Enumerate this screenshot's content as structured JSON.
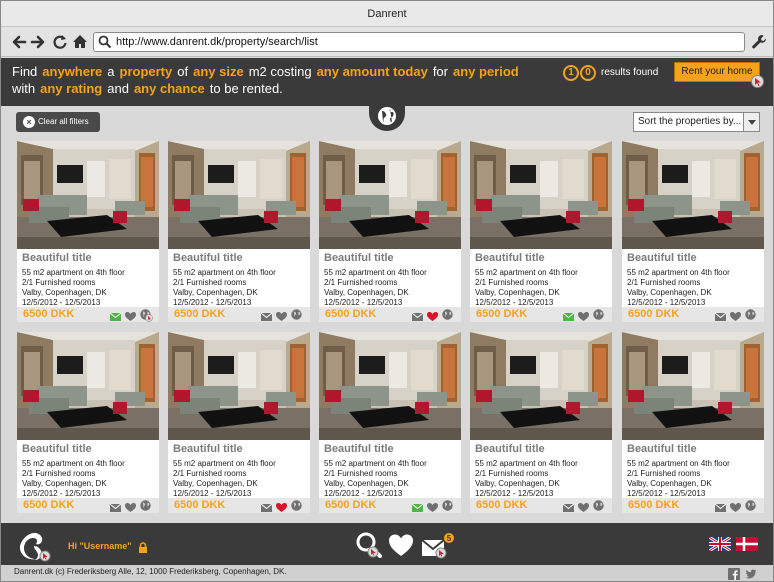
{
  "window": {
    "title": "Danrent"
  },
  "toolbar": {
    "url": "http://www.danrent.dk/property/search/list",
    "icons": [
      "back-arrow-icon",
      "forward-arrow-icon",
      "reload-icon",
      "home-icon",
      "search-icon",
      "wrench-icon"
    ]
  },
  "hero": {
    "line1": {
      "w1": "Find",
      "o1": "anywhere",
      "w2": "a",
      "o2": "property",
      "w3": "of",
      "o3": "any size",
      "w4": "m2 costing",
      "o4": "any amount today",
      "w5": "for",
      "o5": "any period"
    },
    "line2": {
      "w1": "with",
      "o1": "any rating",
      "w2": "and",
      "o2": "any chance",
      "w3": "to be rented."
    },
    "count_digit1": "1",
    "count_digit2": "0",
    "results_label": "results found",
    "rent_button": "Rent your home"
  },
  "filters": {
    "clear_label": "Clear all filters",
    "sort_label": "Sort the properties by..."
  },
  "listings": [
    {
      "title": "Beautiful title",
      "desc1": "55 m2 apartment on 4th floor",
      "desc2": "2/1 Furnished rooms",
      "location": "Valby, Copenhagen, DK",
      "dates": "12/5/2012 - 12/5/2013",
      "price": "6500 DKK",
      "mail_green": true,
      "heart_red": false,
      "cursor_on_globe": true
    },
    {
      "title": "Beautiful title",
      "desc1": "55 m2 apartment on 4th floor",
      "desc2": "2/1 Furnished rooms",
      "location": "Valby, Copenhagen, DK",
      "dates": "12/5/2012 - 12/5/2013",
      "price": "6500 DKK",
      "mail_green": false,
      "heart_red": false,
      "cursor_on_globe": false
    },
    {
      "title": "Beautiful title",
      "desc1": "55 m2 apartment on 4th floor",
      "desc2": "2/1 Furnished rooms",
      "location": "Valby, Copenhagen, DK",
      "dates": "12/5/2012 - 12/5/2013",
      "price": "6500 DKK",
      "mail_green": false,
      "heart_red": true,
      "cursor_on_globe": false
    },
    {
      "title": "Beautiful title",
      "desc1": "55 m2 apartment on 4th floor",
      "desc2": "2/1 Furnished rooms",
      "location": "Valby, Copenhagen, DK",
      "dates": "12/5/2012 - 12/5/2013",
      "price": "6500 DKK",
      "mail_green": true,
      "heart_red": false,
      "cursor_on_globe": false
    },
    {
      "title": "Beautiful title",
      "desc1": "55 m2 apartment on 4th floor",
      "desc2": "2/1 Furnished rooms",
      "location": "Valby, Copenhagen, DK",
      "dates": "12/5/2012 - 12/5/2013",
      "price": "6500 DKK",
      "mail_green": false,
      "heart_red": false,
      "cursor_on_globe": false
    },
    {
      "title": "Beautiful title",
      "desc1": "55 m2 apartment on 4th floor",
      "desc2": "2/1 Furnished rooms",
      "location": "Valby, Copenhagen, DK",
      "dates": "12/5/2012 - 12/5/2013",
      "price": "6500 DKK",
      "mail_green": false,
      "heart_red": false,
      "cursor_on_globe": false
    },
    {
      "title": "Beautiful title",
      "desc1": "55 m2 apartment on 4th floor",
      "desc2": "2/1 Furnished rooms",
      "location": "Valby, Copenhagen, DK",
      "dates": "12/5/2012 - 12/5/2013",
      "price": "6500 DKK",
      "mail_green": false,
      "heart_red": true,
      "cursor_on_globe": false
    },
    {
      "title": "Beautiful title",
      "desc1": "55 m2 apartment on 4th floor",
      "desc2": "2/1 Furnished rooms",
      "location": "Valby, Copenhagen, DK",
      "dates": "12/5/2012 - 12/5/2013",
      "price": "6500 DKK",
      "mail_green": true,
      "heart_red": false,
      "cursor_on_globe": false
    },
    {
      "title": "Beautiful title",
      "desc1": "55 m2 apartment on 4th floor",
      "desc2": "2/1 Furnished rooms",
      "location": "Valby, Copenhagen, DK",
      "dates": "12/5/2012 - 12/5/2013",
      "price": "6500 DKK",
      "mail_green": false,
      "heart_red": false,
      "cursor_on_globe": false
    },
    {
      "title": "Beautiful title",
      "desc1": "55 m2 apartment on 4th floor",
      "desc2": "2/1 Furnished rooms",
      "location": "Valby, Copenhagen, DK",
      "dates": "12/5/2012 - 12/5/2013",
      "price": "6500 DKK",
      "mail_green": false,
      "heart_red": false,
      "cursor_on_globe": false
    }
  ],
  "footer": {
    "greeting": "Hi \"Username\"",
    "mail_badge": "5",
    "icons": [
      "bird-logo-icon",
      "lock-icon",
      "search-icon",
      "heart-icon",
      "mail-icon",
      "uk-flag-icon",
      "danish-flag-icon",
      "facebook-icon",
      "twitter-icon"
    ],
    "copyright": "Danrent.dk (c) Frederiksberg Alle, 12, 1000 Frederiksberg, Copenhagen, DK."
  },
  "colors": {
    "accent": "#f7a21b",
    "dark": "#3a3a3a",
    "mail_green": "#4fb548",
    "heart_red": "#d9142c"
  }
}
